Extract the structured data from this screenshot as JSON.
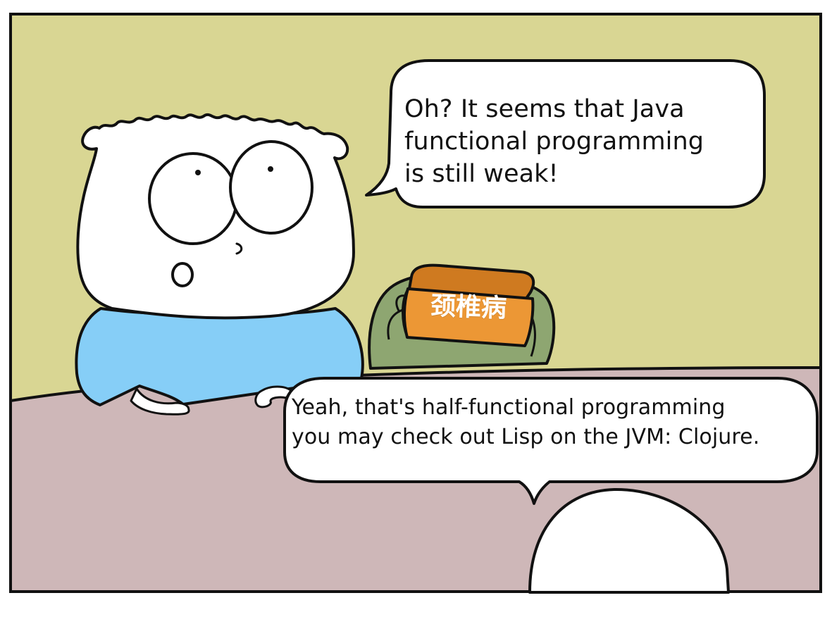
{
  "comic": {
    "top_speech": {
      "lines": [
        "Oh? It seems that Java",
        "functional programming",
        "is still weak!"
      ]
    },
    "bottom_speech": {
      "lines": [
        "Yeah, that's half-functional programming",
        "you may check out Lisp on the JVM: Clojure."
      ]
    },
    "sign_text": "颈椎病"
  },
  "colors": {
    "wall": "#d9d693",
    "table": "#ceb7b8",
    "shirt": "#86cef7",
    "orange_box": "#ec9735",
    "green_character": "#8ea671",
    "outline": "#111111"
  }
}
